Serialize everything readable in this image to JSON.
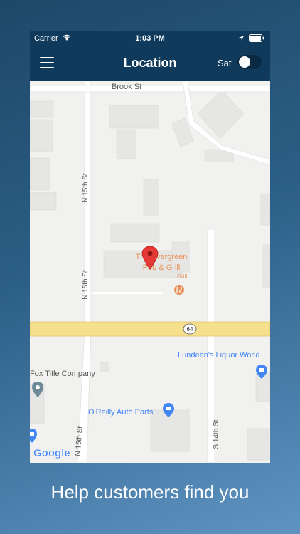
{
  "status_bar": {
    "carrier": "Carrier",
    "time": "1:03 PM",
    "icons": [
      "wifi-icon",
      "location-arrow-icon",
      "battery-icon"
    ]
  },
  "nav": {
    "title": "Location",
    "toggle_label": "Sat",
    "satellite_enabled": false
  },
  "map": {
    "streets": [
      "Brook St",
      "N 15th St",
      "N 15th St",
      "S 14th St",
      "N 15th St"
    ],
    "route_shield": "64",
    "places": {
      "pub": [
        "The Evergreen",
        "Pub & Grill"
      ],
      "pub_category": "Grill",
      "liquor": "Lundeen's Liquor World",
      "fox": "Fox Title Company",
      "auto": "O'Reilly Auto Parts"
    },
    "brand": "Google"
  },
  "colors": {
    "nav_bg": "#0f3a5c",
    "pin_red": "#e53935",
    "poi_orange": "#e8925a",
    "poi_blue": "#4285f4",
    "road_yellow": "#f6e08d"
  },
  "caption": "Help customers find you"
}
